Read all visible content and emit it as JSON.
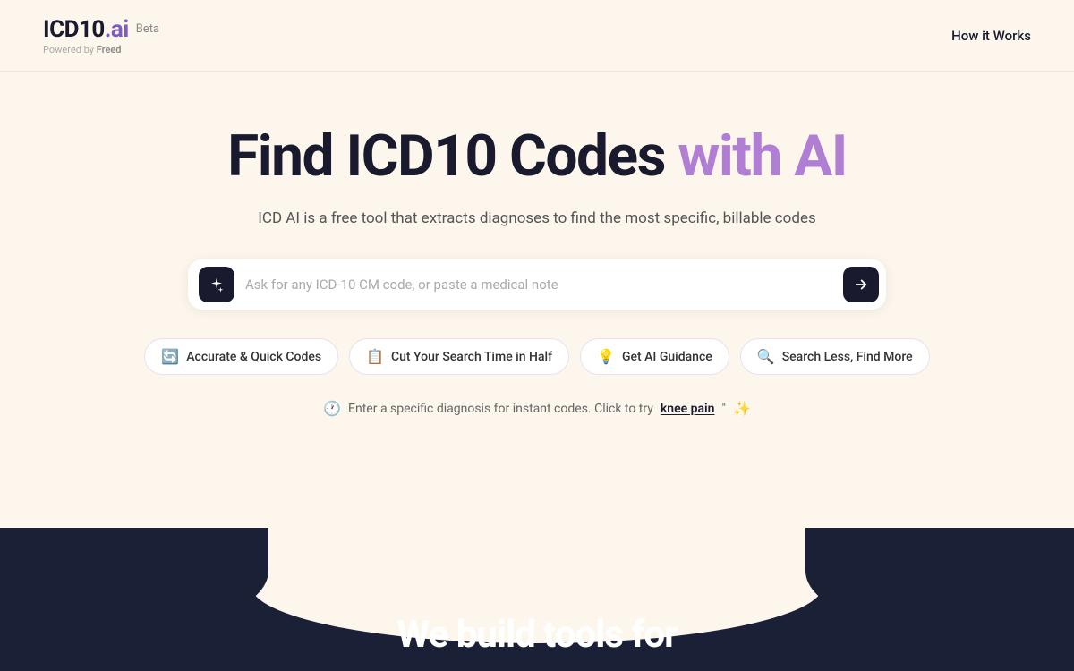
{
  "header": {
    "logo_text": "ICD10",
    "logo_dot": ".",
    "logo_ai": "ai",
    "logo_beta": "Beta",
    "logo_powered": "Powered by",
    "logo_freed": "Freed",
    "nav_link": "How it Works"
  },
  "hero": {
    "title_part1": "Find ICD10 Codes",
    "title_highlight": "with AI",
    "subtitle": "ICD AI is a free tool that extracts diagnoses to find the most specific, billable codes",
    "search_placeholder": "Ask for any ICD-10 CM code, or paste a medical note",
    "pills": [
      {
        "icon": "🔄",
        "label": "Accurate & Quick Codes"
      },
      {
        "icon": "📋",
        "label": "Cut Your Search Time in Half"
      },
      {
        "icon": "💡",
        "label": "Get AI Guidance"
      },
      {
        "icon": "🔍",
        "label": "Search Less, Find More"
      }
    ],
    "hint_text": "Enter a specific diagnosis for instant codes. Click to try",
    "hint_link": "knee pain",
    "sparkle": "✨"
  },
  "bottom": {
    "text": "We build tools for"
  }
}
